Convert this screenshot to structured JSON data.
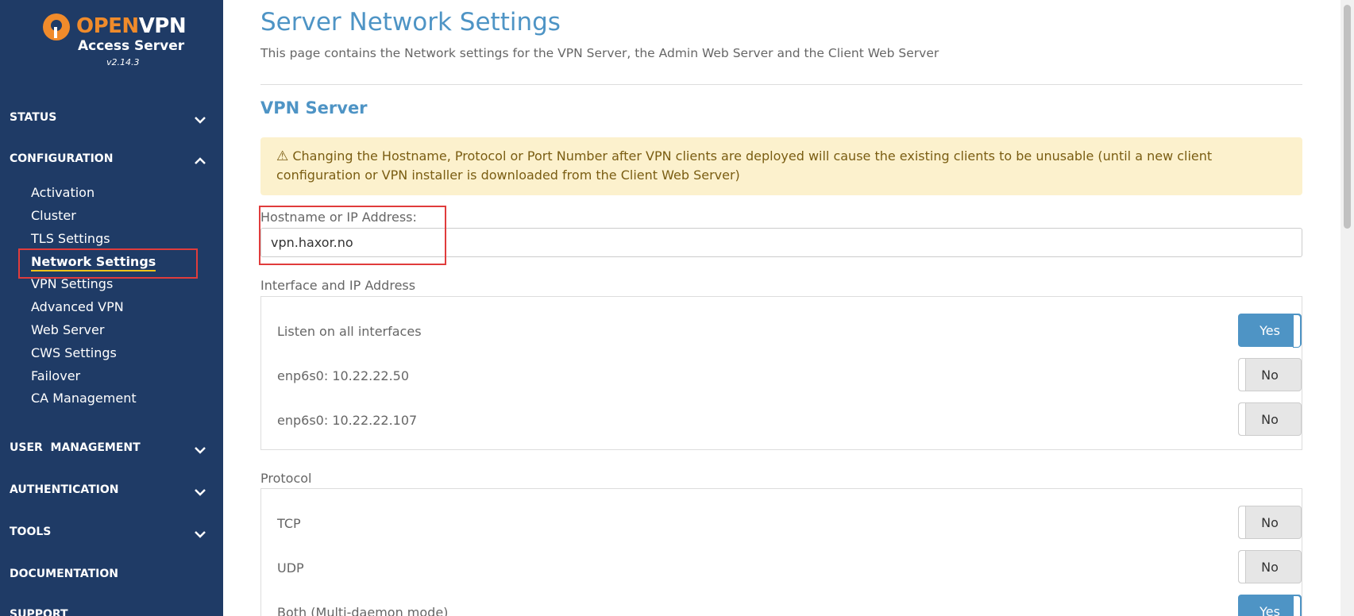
{
  "logo": {
    "brand_open": "OPEN",
    "brand_vpn": "VPN",
    "product": "Access Server",
    "version": "v2.14.3"
  },
  "sidebar": {
    "sections": [
      {
        "label": "STATUS",
        "chevron": "down"
      },
      {
        "label": "CONFIGURATION",
        "chevron": "up"
      },
      {
        "label": "USER  MANAGEMENT",
        "chevron": "down"
      },
      {
        "label": "AUTHENTICATION",
        "chevron": "down"
      },
      {
        "label": "TOOLS",
        "chevron": "down"
      },
      {
        "label": "DOCUMENTATION"
      },
      {
        "label": "SUPPORT"
      }
    ],
    "config_items": [
      {
        "label": "Activation"
      },
      {
        "label": "Cluster"
      },
      {
        "label": "TLS Settings"
      },
      {
        "label": "Network Settings",
        "active": true
      },
      {
        "label": "VPN Settings"
      },
      {
        "label": "Advanced VPN"
      },
      {
        "label": "Web Server"
      },
      {
        "label": "CWS Settings"
      },
      {
        "label": "Failover"
      },
      {
        "label": "CA Management"
      }
    ]
  },
  "page": {
    "title": "Server Network Settings",
    "description": "This page contains the Network settings for the VPN Server, the Admin Web Server and the Client Web Server",
    "section_title": "VPN Server",
    "alert": {
      "icon": "warning-icon",
      "text": "Changing the Hostname, Protocol or Port Number after VPN clients are deployed will cause the existing clients to be unusable (until a new client configuration or VPN installer is downloaded from the Client Web Server)"
    },
    "hostname": {
      "label": "Hostname or IP Address:",
      "value": "vpn.haxor.no"
    },
    "interface": {
      "label": "Interface and IP Address",
      "rows": [
        {
          "label": "Listen on all interfaces",
          "toggle": "Yes"
        },
        {
          "label": "enp6s0: 10.22.22.50",
          "toggle": "No"
        },
        {
          "label": "enp6s0: 10.22.22.107",
          "toggle": "No"
        }
      ]
    },
    "protocol": {
      "label": "Protocol",
      "rows": [
        {
          "label": "TCP",
          "toggle": "No"
        },
        {
          "label": "UDP",
          "toggle": "No"
        },
        {
          "label": "Both (Multi-daemon mode)",
          "toggle": "Yes"
        }
      ]
    }
  },
  "colors": {
    "sidebar_bg": "#1f3b66",
    "accent": "#4e94c5",
    "brand_orange": "#f08b2b",
    "alert_bg": "#fcf1cd",
    "highlight_red": "#e03c3c"
  }
}
